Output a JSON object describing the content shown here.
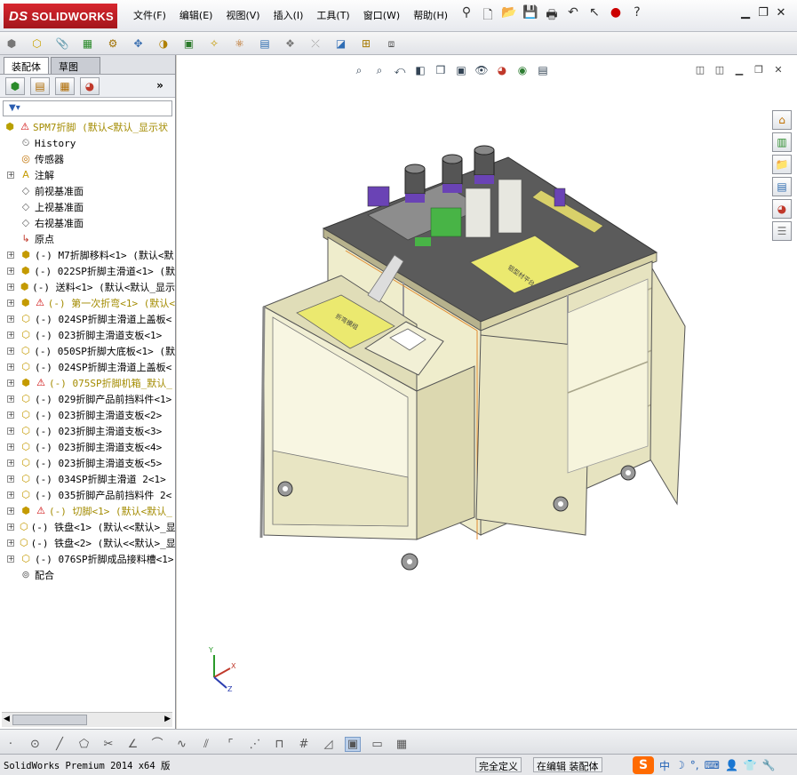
{
  "app": {
    "logo_text": "SOLIDWORKS",
    "logo_ds": "DS"
  },
  "menu": [
    "文件(F)",
    "编辑(E)",
    "视图(V)",
    "插入(I)",
    "工具(T)",
    "窗口(W)",
    "帮助(H)"
  ],
  "panel": {
    "tabs": [
      "装配体",
      "草图"
    ],
    "more_label": "»"
  },
  "tree": {
    "root": {
      "label": "SPM7折脚  (默认<默认_显示状"
    },
    "items": [
      {
        "label": "History",
        "icon": "history-icon",
        "expandable": false
      },
      {
        "label": "传感器",
        "icon": "sensor-icon",
        "expandable": false
      },
      {
        "label": "注解",
        "icon": "annotation-icon",
        "expandable": true
      },
      {
        "label": "前视基准面",
        "icon": "plane-icon",
        "expandable": false
      },
      {
        "label": "上视基准面",
        "icon": "plane-icon",
        "expandable": false
      },
      {
        "label": "右视基准面",
        "icon": "plane-icon",
        "expandable": false
      },
      {
        "label": "原点",
        "icon": "origin-icon",
        "expandable": false
      },
      {
        "label": "(-) M7折脚移料<1> (默认<默",
        "icon": "assembly-icon",
        "expandable": true
      },
      {
        "label": "(-) 022SP折脚主滑道<1> (默",
        "icon": "assembly-icon",
        "expandable": true
      },
      {
        "label": "(-) 送料<1> (默认<默认_显示",
        "icon": "assembly-icon",
        "expandable": true
      },
      {
        "label": "(-) 第一次折弯<1> (默认<",
        "icon": "assembly-icon",
        "expandable": true,
        "warning": true,
        "yellow": true
      },
      {
        "label": "(-) 024SP折脚主滑道上盖板<",
        "icon": "part-icon",
        "expandable": true
      },
      {
        "label": "(-) 023折脚主滑道支板<1>",
        "icon": "part-icon",
        "expandable": true
      },
      {
        "label": "(-) 050SP折脚大底板<1> (默",
        "icon": "part-icon",
        "expandable": true
      },
      {
        "label": "(-) 024SP折脚主滑道上盖板<",
        "icon": "part-icon",
        "expandable": true
      },
      {
        "label": "(-) 075SP折脚机箱_默认_",
        "icon": "assembly-icon",
        "expandable": true,
        "warning": true,
        "yellow": true
      },
      {
        "label": "(-) 029折脚产品前挡料件<1>",
        "icon": "part-icon",
        "expandable": true
      },
      {
        "label": "(-) 023折脚主滑道支板<2>",
        "icon": "part-icon",
        "expandable": true
      },
      {
        "label": "(-) 023折脚主滑道支板<3>",
        "icon": "part-icon",
        "expandable": true
      },
      {
        "label": "(-) 023折脚主滑道支板<4>",
        "icon": "part-icon",
        "expandable": true
      },
      {
        "label": "(-) 023折脚主滑道支板<5>",
        "icon": "part-icon",
        "expandable": true
      },
      {
        "label": "(-) 034SP折脚主滑道 2<1>",
        "icon": "part-icon",
        "expandable": true
      },
      {
        "label": "(-) 035折脚产品前挡料件 2<",
        "icon": "part-icon",
        "expandable": true
      },
      {
        "label": "(-) 切脚<1> (默认<默认_",
        "icon": "assembly-icon",
        "expandable": true,
        "warning": true,
        "yellow": true
      },
      {
        "label": "(-) 铁盘<1> (默认<<默认>_显",
        "icon": "part-icon",
        "expandable": true
      },
      {
        "label": "(-) 铁盘<2> (默认<<默认>_显",
        "icon": "part-icon",
        "expandable": true
      },
      {
        "label": "(-) 076SP折脚成品接料槽<1>",
        "icon": "part-icon",
        "expandable": true
      },
      {
        "label": "配合",
        "icon": "mates-icon",
        "expandable": false
      }
    ]
  },
  "model_labels": [
    "折弯模组",
    "铝型材平台"
  ],
  "triad": {
    "x": "X",
    "y": "Y",
    "z": "Z"
  },
  "status": {
    "app_name": "SolidWorks Premium 2014 x64 版",
    "definition": "完全定义",
    "mode": "在编辑 装配体"
  },
  "ime": {
    "logo": "S",
    "lang": "中"
  },
  "colors": {
    "logo_red": "#c41f26",
    "cabinet": "#efedcc",
    "tabletop": "#5e5e5e",
    "selected_tab": "#ffffff"
  }
}
